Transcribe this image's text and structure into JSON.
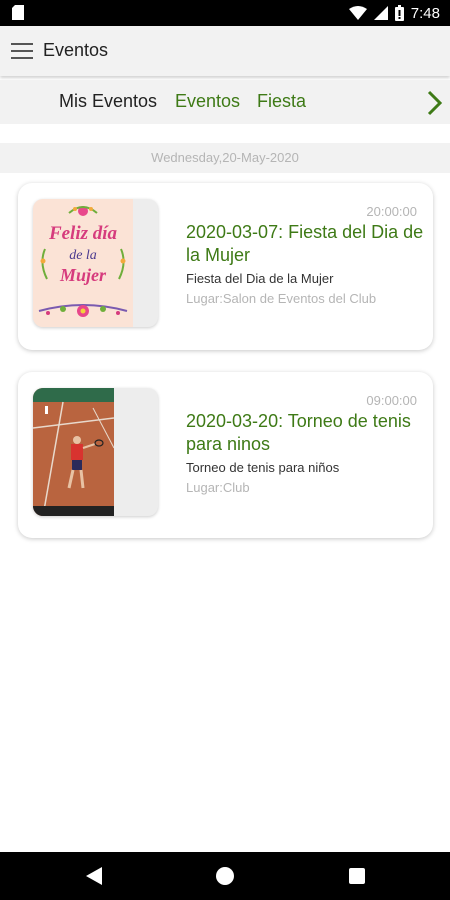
{
  "status_bar": {
    "time": "7:48",
    "icons": [
      "sim-card-icon",
      "wifi-icon",
      "signal-icon",
      "battery-icon"
    ]
  },
  "app_bar": {
    "title": "Eventos",
    "menu_icon": "hamburger-menu-icon"
  },
  "tabs": {
    "items": [
      {
        "label": "Mis Eventos",
        "selected": true
      },
      {
        "label": "Eventos",
        "selected": false
      },
      {
        "label": "Fiesta",
        "selected": false
      }
    ],
    "next_icon": "chevron-right-icon"
  },
  "date_header": "Wednesday,20-May-2020",
  "events": [
    {
      "time": "20:00:00",
      "title": "2020-03-07: Fiesta del Dia de la Mujer",
      "description": "Fiesta del Dia de la Mujer",
      "place": "Lugar:Salon de Eventos del Club",
      "image": {
        "line1": "Feliz día",
        "line2": "de la",
        "line3": "Mujer"
      }
    },
    {
      "time": "09:00:00",
      "title": "2020-03-20: Torneo de tenis para ninos",
      "description": "Torneo de tenis para niños",
      "place": "Lugar:Club",
      "image": {
        "caption": ""
      }
    }
  ],
  "nav_bar": {
    "icons": [
      "back-icon",
      "home-icon",
      "recents-icon"
    ]
  },
  "colors": {
    "accent_green": "#3e7a16",
    "muted_text": "#b5b5b5",
    "bar_bg": "#f2f2f2"
  }
}
